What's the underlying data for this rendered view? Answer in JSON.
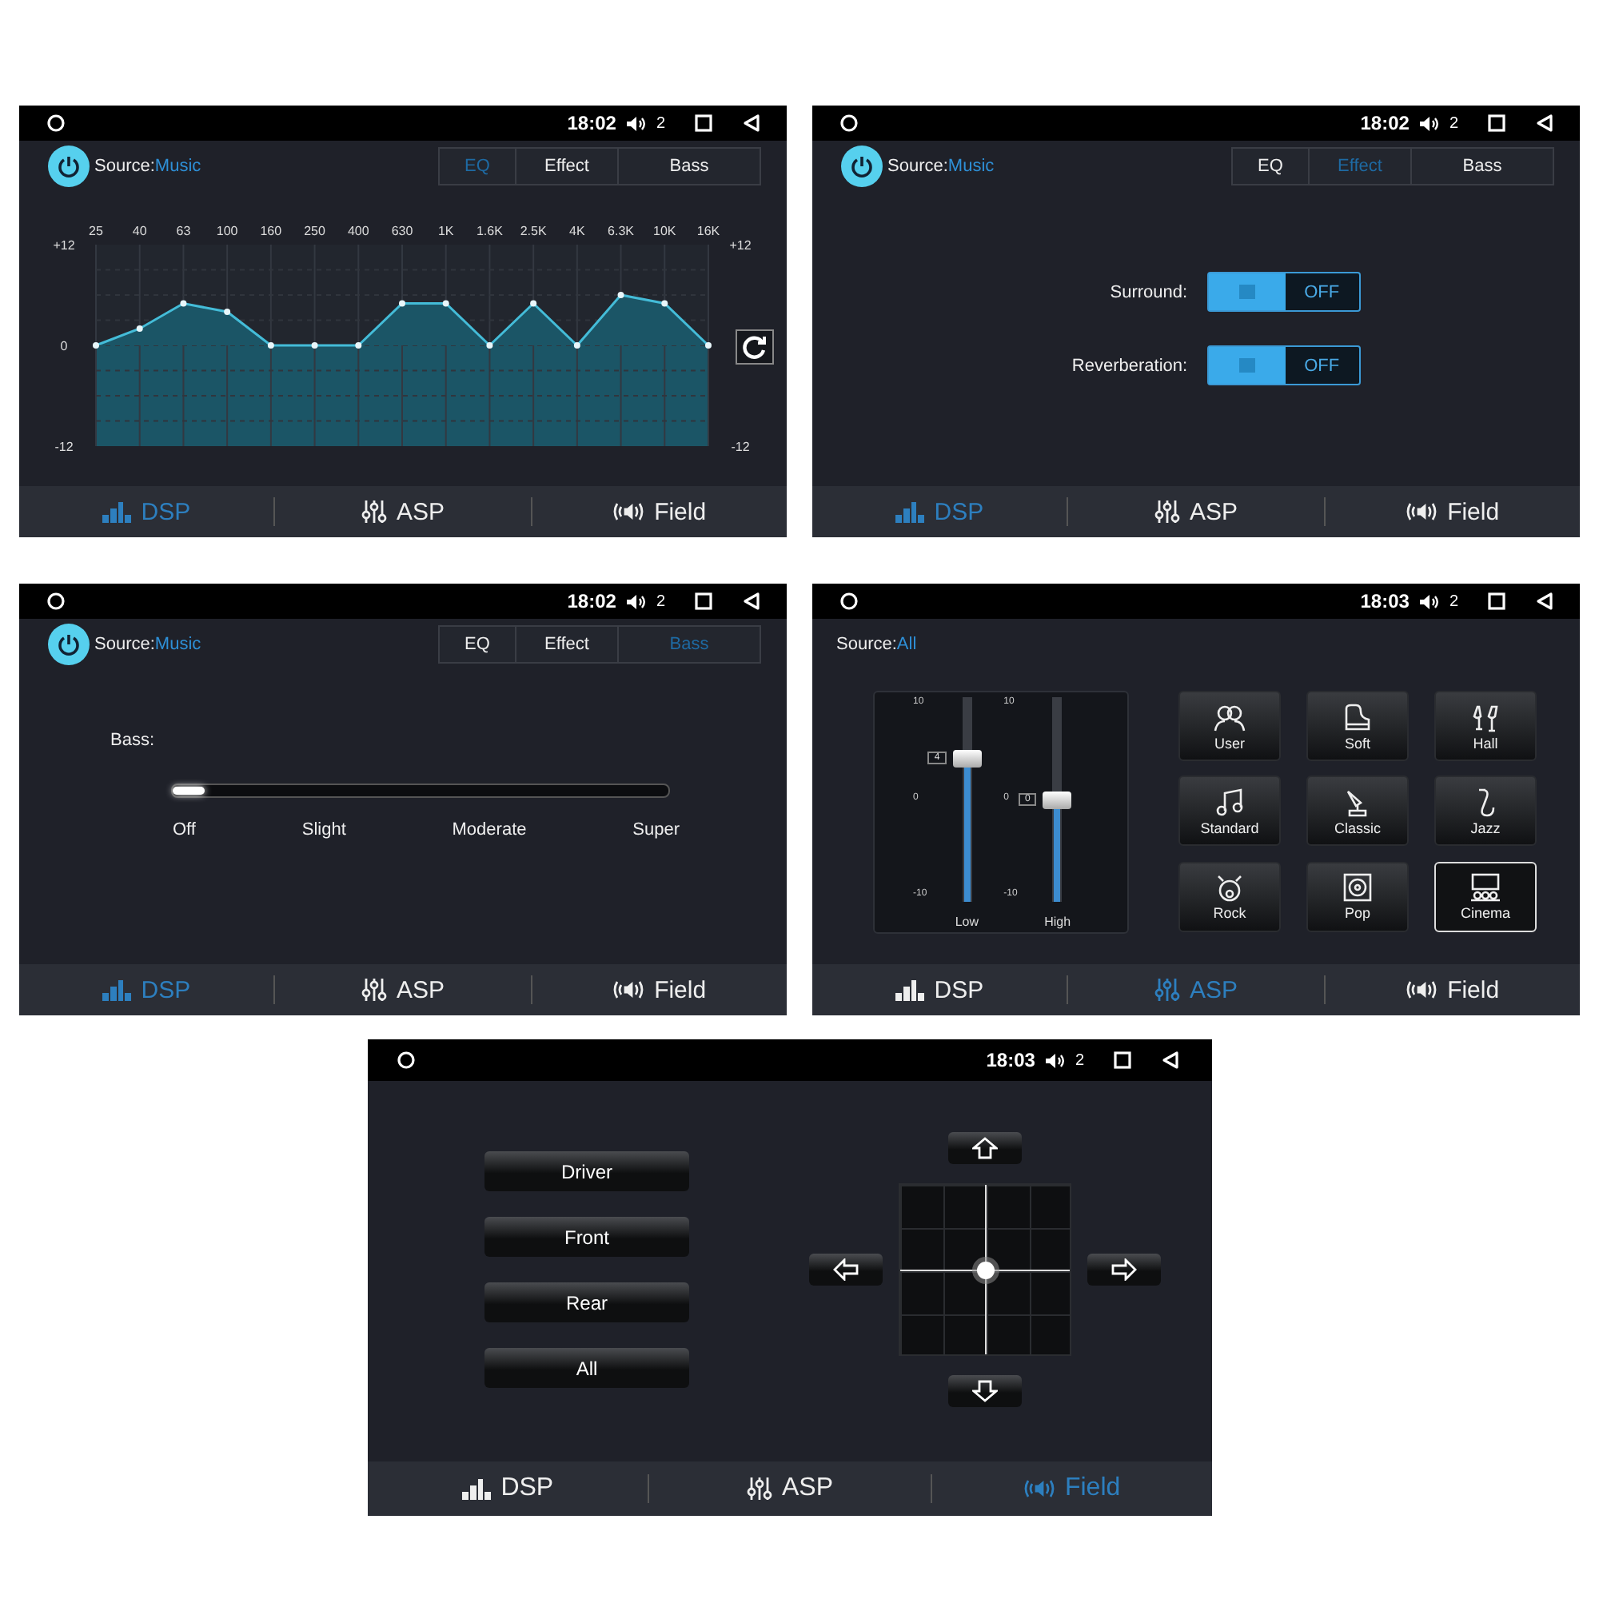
{
  "panels": [
    {
      "kind": "eq",
      "status": {
        "time": "18:02",
        "volume": "2"
      },
      "source": {
        "label": "Source:",
        "value": "Music",
        "power": true
      },
      "tabs": [
        {
          "label": "EQ",
          "selected": true
        },
        {
          "label": "Effect",
          "selected": false
        },
        {
          "label": "Bass",
          "selected": false
        }
      ],
      "chart_data": {
        "type": "area",
        "categories": [
          "25",
          "40",
          "63",
          "100",
          "160",
          "250",
          "400",
          "630",
          "1K",
          "1.6K",
          "2.5K",
          "4K",
          "6.3K",
          "10K",
          "16K"
        ],
        "values": [
          0,
          2,
          5,
          4,
          0,
          0,
          0,
          5,
          5,
          0,
          5,
          0,
          6,
          5,
          0
        ],
        "ylim": [
          -12,
          12
        ],
        "yticks": [
          {
            "value": 12,
            "label": "+12"
          },
          0,
          -12
        ],
        "grid": true
      },
      "right_labels": [
        "+12",
        "-12"
      ],
      "nav": [
        {
          "label": "DSP",
          "selected": true
        },
        {
          "label": "ASP",
          "selected": false
        },
        {
          "label": "Field",
          "selected": false
        }
      ]
    },
    {
      "kind": "effect",
      "status": {
        "time": "18:02",
        "volume": "2"
      },
      "source": {
        "label": "Source:",
        "value": "Music",
        "power": true
      },
      "tabs": [
        {
          "label": "EQ",
          "selected": false
        },
        {
          "label": "Effect",
          "selected": true
        },
        {
          "label": "Bass",
          "selected": false
        }
      ],
      "toggles": [
        {
          "label": "Surround:",
          "state": "OFF",
          "on": false
        },
        {
          "label": "Reverberation:",
          "state": "OFF",
          "on": false
        }
      ],
      "nav": [
        {
          "label": "DSP",
          "selected": true
        },
        {
          "label": "ASP",
          "selected": false
        },
        {
          "label": "Field",
          "selected": false
        }
      ]
    },
    {
      "kind": "bass",
      "status": {
        "time": "18:02",
        "volume": "2"
      },
      "source": {
        "label": "Source:",
        "value": "Music",
        "power": true
      },
      "tabs": [
        {
          "label": "EQ",
          "selected": false
        },
        {
          "label": "Effect",
          "selected": false
        },
        {
          "label": "Bass",
          "selected": true
        }
      ],
      "bass": {
        "label": "Bass:",
        "level": 0,
        "stops": [
          "Off",
          "Slight",
          "Moderate",
          "Super"
        ]
      },
      "nav": [
        {
          "label": "DSP",
          "selected": true
        },
        {
          "label": "ASP",
          "selected": false
        },
        {
          "label": "Field",
          "selected": false
        }
      ]
    },
    {
      "kind": "asp",
      "status": {
        "time": "18:03",
        "volume": "2"
      },
      "source": {
        "label": "Source:",
        "value": "All"
      },
      "sliders": [
        {
          "label": "Low",
          "reading": "4",
          "level": 0.7,
          "scale": [
            "10",
            "0",
            "-10"
          ]
        },
        {
          "label": "High",
          "reading": "0",
          "level": 0.5,
          "scale": [
            "10",
            "0",
            "-10"
          ]
        }
      ],
      "presets": [
        {
          "label": "User",
          "selected": false
        },
        {
          "label": "Soft",
          "selected": false
        },
        {
          "label": "Hall",
          "selected": false
        },
        {
          "label": "Standard",
          "selected": false
        },
        {
          "label": "Classic",
          "selected": false
        },
        {
          "label": "Jazz",
          "selected": false
        },
        {
          "label": "Rock",
          "selected": false
        },
        {
          "label": "Pop",
          "selected": false
        },
        {
          "label": "Cinema",
          "selected": true
        }
      ],
      "nav": [
        {
          "label": "DSP",
          "selected": false
        },
        {
          "label": "ASP",
          "selected": true
        },
        {
          "label": "Field",
          "selected": false
        }
      ]
    },
    {
      "kind": "field",
      "status": {
        "time": "18:03",
        "volume": "2"
      },
      "positions": [
        "Driver",
        "Front",
        "Rear",
        "All"
      ],
      "nav": [
        {
          "label": "DSP",
          "selected": false
        },
        {
          "label": "ASP",
          "selected": false
        },
        {
          "label": "Field",
          "selected": true
        }
      ]
    }
  ]
}
